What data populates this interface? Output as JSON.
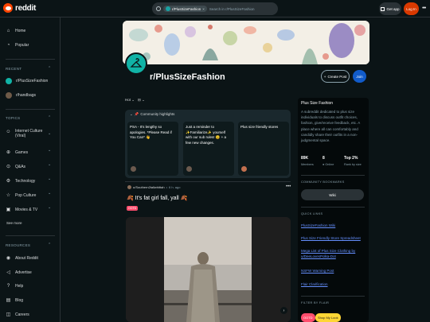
{
  "header": {
    "logo_text": "reddit",
    "search_chip": "r/PlusSizeFashion",
    "search_placeholder": "Search in r/PlusSizeFashion",
    "get_app_label": "Get app",
    "login_label": "Log In",
    "more_icon": "ellipsis-icon"
  },
  "sidebar": {
    "nav": [
      {
        "label": "Home",
        "icon": "home-icon"
      },
      {
        "label": "Popular",
        "icon": "popular-icon"
      }
    ],
    "recent_heading": "RECENT",
    "recent": [
      {
        "label": "r/PlusSizeFashion",
        "color": "#11b3a6"
      },
      {
        "label": "r/handbags",
        "color": "#6e5a48"
      }
    ],
    "topics_heading": "TOPICS",
    "topics": [
      {
        "label": "Internet Culture (Viral)",
        "icon": "internet-icon"
      },
      {
        "label": "Games",
        "icon": "gamepad-icon"
      },
      {
        "label": "Q&As",
        "icon": "qa-icon"
      },
      {
        "label": "Technology",
        "icon": "tech-icon"
      },
      {
        "label": "Pop Culture",
        "icon": "star-icon"
      },
      {
        "label": "Movies & TV",
        "icon": "film-icon"
      }
    ],
    "see_more": "See more",
    "resources_heading": "RESOURCES",
    "resources": [
      {
        "label": "About Reddit",
        "icon": "reddit-icon"
      },
      {
        "label": "Advertise",
        "icon": "megaphone-icon"
      },
      {
        "label": "Help",
        "icon": "help-icon"
      },
      {
        "label": "Blog",
        "icon": "blog-icon"
      },
      {
        "label": "Careers",
        "icon": "briefcase-icon"
      }
    ]
  },
  "subreddit": {
    "name": "r/PlusSizeFashion",
    "create_post": "Create Post",
    "join": "Join",
    "sort": "Hot"
  },
  "highlights": {
    "title": "Community highlights",
    "cards": [
      {
        "text": "PSA - It's lengthy so apologies. *Please Read if You Can* 👋"
      },
      {
        "text": "Just a reminder to ✨Familiarize✨ yourself with our sub rules! 😉 + a few new changes."
      },
      {
        "text": "Plus size friendly stores"
      }
    ]
  },
  "post": {
    "author": "u/Southern2tallwhittah",
    "age": "6 h. ago",
    "title": "🍂 It's fat girl fall, yall 🍂",
    "flair": "OOTD"
  },
  "about": {
    "title": "Plus Size Fashion",
    "description": "A subreddit dedicated to plus size individuals to discuss outfit choices, fashion, give/receive feedback, etc. A place where all can comfortably and candidly share their outfits in a non-judgmental space.",
    "stats": [
      {
        "value": "89K",
        "label": "Members"
      },
      {
        "value": "8",
        "label": "● Online"
      },
      {
        "value": "Top 2%",
        "label": "Rank by size"
      }
    ],
    "bookmarks_heading": "COMMUNITY BOOKMARKS",
    "wiki": "Wiki",
    "links_heading": "QUICK LINKS",
    "links": [
      "PlusSizeFashion Wiki",
      "Plus Size Friendly Store Spreadsheet",
      "Mega List of Plus Size Clothing by u/DeeLovesPolka-Dot",
      "NSFW Warning Post",
      "Flair Clarification"
    ],
    "flair_heading": "FILTER BY FLAIR",
    "flairs": [
      {
        "label": "OOTD",
        "bg": "#ff4d6d",
        "fg": "#ffffff"
      },
      {
        "label": "Shop My Look",
        "bg": "#ffd635",
        "fg": "#1a1a1b"
      }
    ]
  }
}
